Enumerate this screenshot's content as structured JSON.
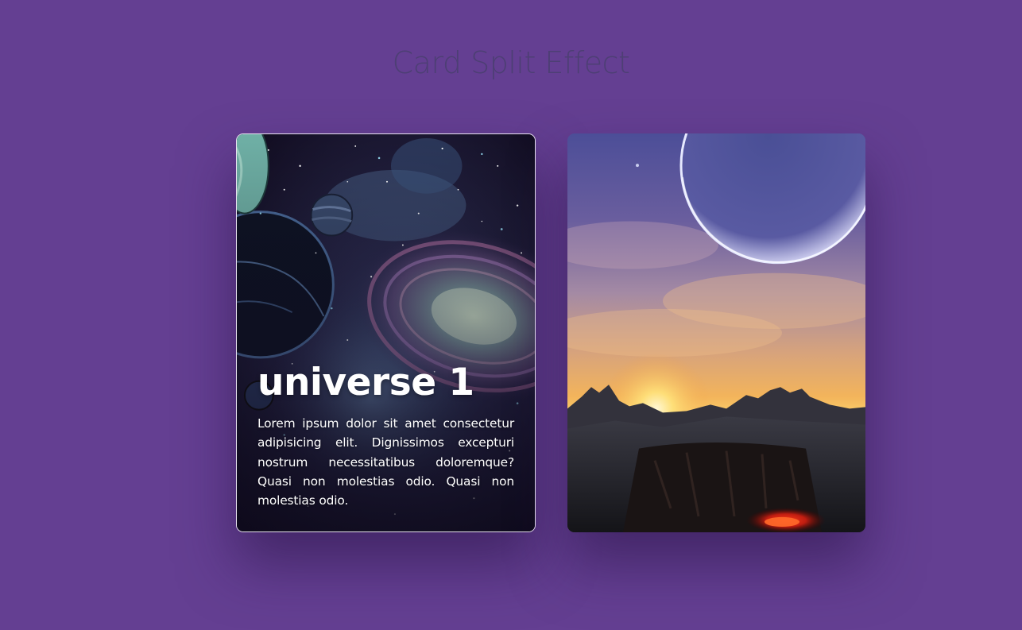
{
  "page": {
    "title": "Card Split Effect",
    "background_color": "#643f92",
    "title_color": "#4d3f74"
  },
  "cards": [
    {
      "title": "universe 1",
      "text": "Lorem ipsum dolor sit amet consectetur adipisicing elit. Dignissimos excepturi nostrum necessitatibus doloremque? Quasi non molestias odio. Quasi non molestias odio.",
      "image": "space-galaxy-illustration"
    },
    {
      "image": "alien-planet-sunset-landscape"
    }
  ]
}
